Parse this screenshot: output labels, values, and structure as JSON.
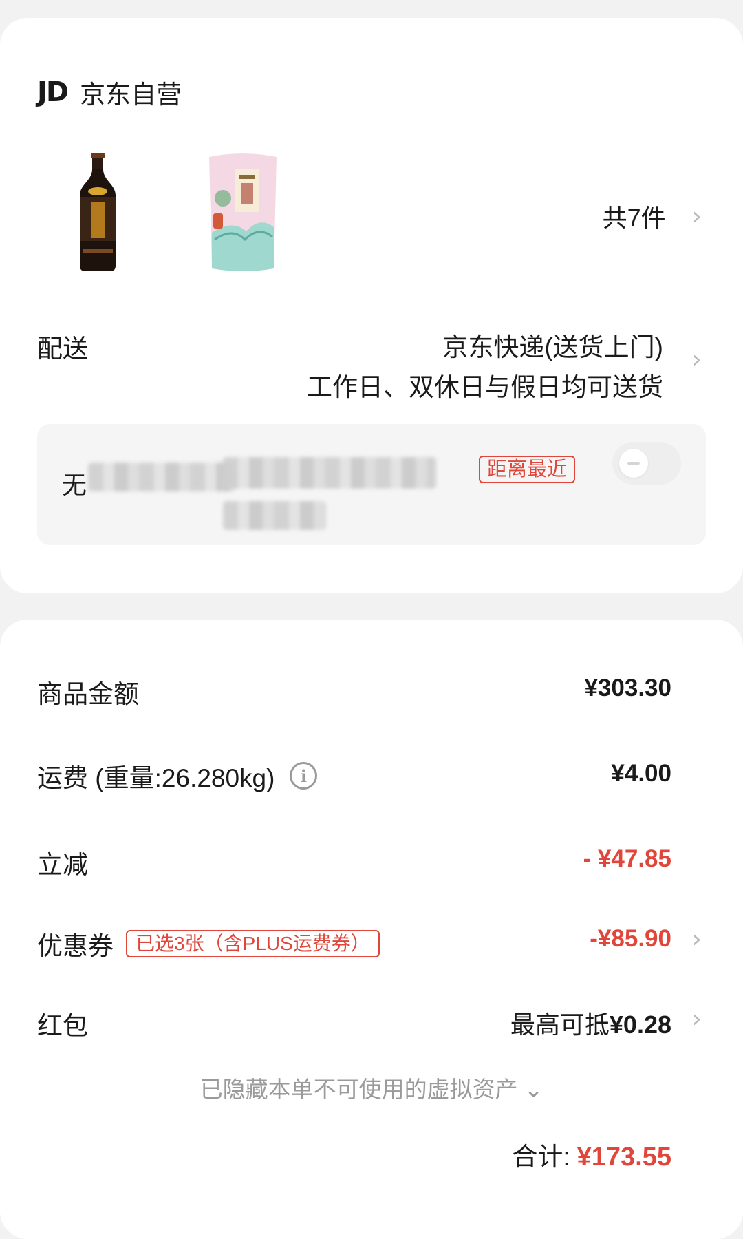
{
  "store": {
    "logo": "JD",
    "name": "京东自营"
  },
  "items": {
    "count_label": "共7件"
  },
  "delivery": {
    "label": "配送",
    "method": "京东快递(送货上门)",
    "schedule": "工作日、双休日与假日均可送货"
  },
  "pickup": {
    "label": "无",
    "tag": "距离最近"
  },
  "fees": {
    "goods": {
      "label": "商品金额",
      "value": "¥303.30"
    },
    "shipping": {
      "label": "运费 (重量:26.280kg)",
      "value": "¥4.00",
      "info_icon": "i"
    },
    "discount": {
      "label": "立减",
      "value": "- ¥47.85"
    },
    "coupon": {
      "label": "优惠券",
      "tag": "已选3张（含PLUS运费券）",
      "value": "-¥85.90"
    },
    "redpacket": {
      "label": "红包",
      "prefix": "最高可抵",
      "value": "¥0.28"
    }
  },
  "hidden_assets": "已隐藏本单不可使用的虚拟资产 ⌄",
  "total": {
    "label": "合计:",
    "value": "¥173.55"
  },
  "colors": {
    "accent": "#e0463a",
    "background": "#f2f2f2"
  },
  "icons": {
    "chevron": "chevron-right-icon",
    "info": "info-icon"
  }
}
